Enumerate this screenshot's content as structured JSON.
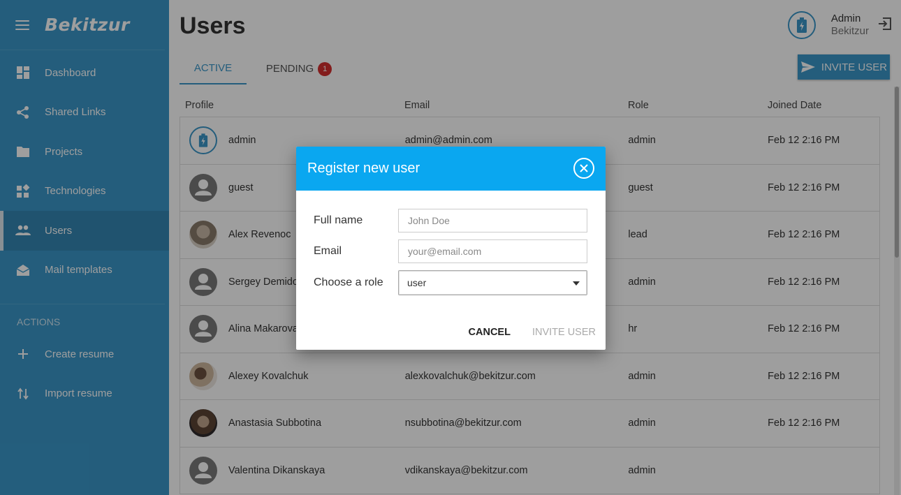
{
  "app": {
    "brand": "Bekitzur"
  },
  "sidebar": {
    "items": [
      {
        "label": "Dashboard",
        "icon": "dashboard-icon"
      },
      {
        "label": "Shared Links",
        "icon": "share-icon"
      },
      {
        "label": "Projects",
        "icon": "folder-icon"
      },
      {
        "label": "Technologies",
        "icon": "widgets-icon"
      },
      {
        "label": "Users",
        "icon": "people-icon",
        "active": true
      },
      {
        "label": "Mail templates",
        "icon": "mail-icon"
      }
    ],
    "actions_label": "ACTIONS",
    "actions": [
      {
        "label": "Create resume",
        "icon": "plus-icon"
      },
      {
        "label": "Import resume",
        "icon": "import-icon"
      }
    ]
  },
  "header": {
    "title": "Users",
    "user_name": "Admin",
    "user_org": "Bekitzur"
  },
  "tabs": [
    {
      "label": "ACTIVE",
      "active": true
    },
    {
      "label": "PENDING",
      "badge": "1"
    }
  ],
  "invite_button_label": "INVITE USER",
  "table": {
    "columns": [
      "Profile",
      "Email",
      "Role",
      "Joined Date"
    ],
    "rows": [
      {
        "name": "admin",
        "email": "admin@admin.com",
        "role": "admin",
        "joined": "Feb 12 2:16 PM"
      },
      {
        "name": "guest",
        "email": "",
        "role": "guest",
        "joined": "Feb 12 2:16 PM"
      },
      {
        "name": "Alex Revenoc",
        "email": "",
        "role": "lead",
        "joined": "Feb 12 2:16 PM"
      },
      {
        "name": "Sergey Demidov",
        "email": "",
        "role": "admin",
        "joined": "Feb 12 2:16 PM"
      },
      {
        "name": "Alina Makarova",
        "email": "",
        "role": "hr",
        "joined": "Feb 12 2:16 PM"
      },
      {
        "name": "Alexey Kovalchuk",
        "email": "alexkovalchuk@bekitzur.com",
        "role": "admin",
        "joined": "Feb 12 2:16 PM"
      },
      {
        "name": "Anastasia Subbotina",
        "email": "nsubbotina@bekitzur.com",
        "role": "admin",
        "joined": "Feb 12 2:16 PM"
      },
      {
        "name": "Valentina Dikanskaya",
        "email": "vdikanskaya@bekitzur.com",
        "role": "admin",
        "joined": ""
      }
    ]
  },
  "dialog": {
    "title": "Register new user",
    "fields": {
      "full_name": {
        "label": "Full name",
        "placeholder": "John Doe"
      },
      "email": {
        "label": "Email",
        "placeholder": "your@email.com"
      },
      "role": {
        "label": "Choose a role",
        "value": "user"
      }
    },
    "cancel_label": "CANCEL",
    "invite_label": "INVITE USER"
  },
  "colors": {
    "sidebar": "#3a97c9",
    "dialog_header": "#0aa7f0",
    "badge": "#d32f2f"
  }
}
